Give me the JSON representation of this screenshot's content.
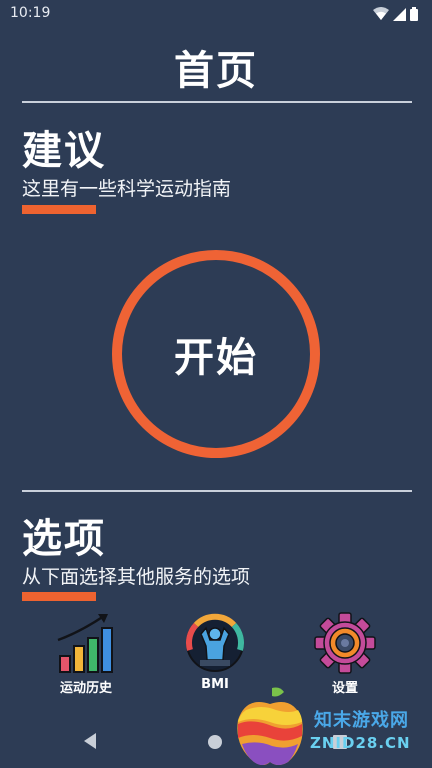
{
  "status_bar": {
    "time": "10:19"
  },
  "header": {
    "title": "首页"
  },
  "suggestion": {
    "title": "建议",
    "subtitle": "这里有一些科学运动指南"
  },
  "start": {
    "label": "开始"
  },
  "options": {
    "title": "选项",
    "subtitle": "从下面选择其他服务的选项",
    "items": [
      {
        "label": "运动历史",
        "icon": "bar-chart-icon"
      },
      {
        "label": "BMI",
        "icon": "bmi-gauge-icon"
      },
      {
        "label": "设置",
        "icon": "gear-icon"
      }
    ]
  },
  "watermark": {
    "text": "知末游戏网",
    "sub": "ZNID28.CN"
  },
  "colors": {
    "background": "#2d3c55",
    "accent": "#ee6330",
    "text": "#ffffff"
  }
}
